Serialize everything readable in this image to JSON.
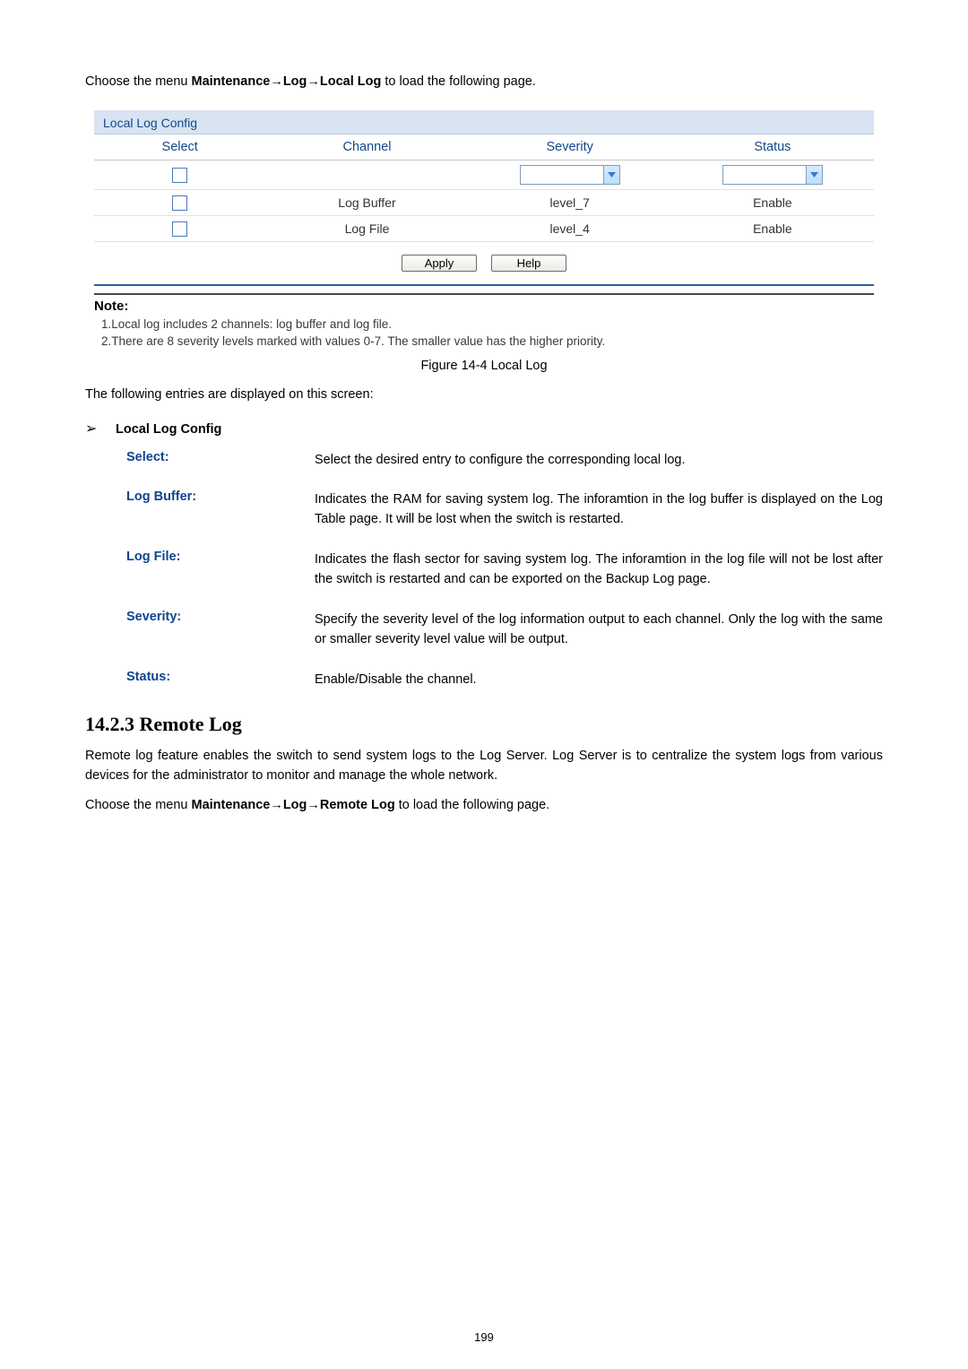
{
  "menu_line": {
    "prefix": "Choose the menu ",
    "path": "Maintenance→Log→Local Log",
    "suffix": " to load the following page."
  },
  "panel": {
    "title": "Local Log Config",
    "headers": {
      "select": "Select",
      "channel": "Channel",
      "severity": "Severity",
      "status": "Status"
    },
    "rows": [
      {
        "channel": "",
        "severity": "",
        "status": ""
      },
      {
        "channel": "Log Buffer",
        "severity": "level_7",
        "status": "Enable"
      },
      {
        "channel": "Log File",
        "severity": "level_4",
        "status": "Enable"
      }
    ],
    "buttons": {
      "apply": "Apply",
      "help": "Help"
    }
  },
  "note": {
    "title": "Note:",
    "line1": "1.Local log includes 2 channels: log buffer and log file.",
    "line2": "2.There are 8 severity levels marked with values 0-7. The smaller value has the higher priority."
  },
  "caption": "Figure 14-4 Local Log",
  "intro": "The following entries are displayed on this screen:",
  "section_label": "Local Log Config",
  "fields": {
    "select": {
      "label": "Select:",
      "desc": "Select the desired entry to configure the corresponding local log."
    },
    "log_buffer": {
      "label": "Log Buffer:",
      "desc": "Indicates the RAM for saving system log. The inforamtion in the log buffer is displayed on the Log Table page. It will be lost when the switch is restarted."
    },
    "log_file": {
      "label": "Log File:",
      "desc": "Indicates the flash sector for saving system log. The inforamtion in the log file will not be lost after the switch is restarted and can be exported on the Backup Log page."
    },
    "severity": {
      "label": "Severity:",
      "desc": "Specify the severity level of the log information output to each channel. Only the log with the same or smaller severity level value will be output."
    },
    "status": {
      "label": "Status:",
      "desc": "Enable/Disable the channel."
    }
  },
  "heading": "14.2.3  Remote Log",
  "remote_para": "Remote log feature enables the switch to send system logs to the Log Server. Log Server is to centralize the system logs from various devices for the administrator to monitor and manage the whole network.",
  "menu_line2": {
    "prefix": "Choose the menu ",
    "path": "Maintenance→Log→Remote Log",
    "suffix": " to load the following page."
  },
  "page_number": "199"
}
